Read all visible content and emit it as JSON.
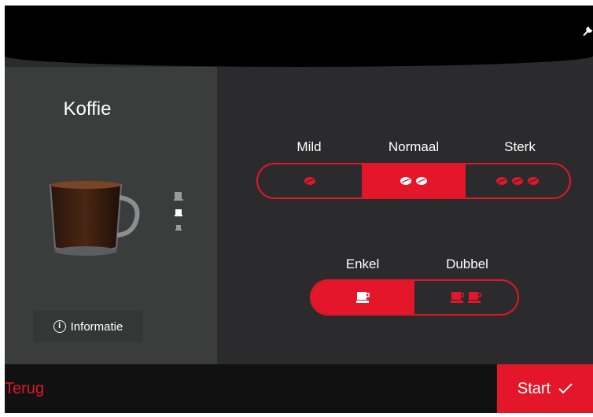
{
  "colors": {
    "accent": "#e3162a",
    "background": "#2b2b2d",
    "panel": "#3b3d3c"
  },
  "product": {
    "title": "Koffie",
    "info_label": "Informatie"
  },
  "strength": {
    "options": [
      {
        "label": "Mild",
        "beans": 1,
        "selected": false
      },
      {
        "label": "Normaal",
        "beans": 2,
        "selected": true
      },
      {
        "label": "Sterk",
        "beans": 3,
        "selected": false
      }
    ]
  },
  "quantity": {
    "options": [
      {
        "label": "Enkel",
        "cups": 1,
        "selected": true
      },
      {
        "label": "Dubbel",
        "cups": 2,
        "selected": false
      }
    ]
  },
  "footer": {
    "back_label": "Terug",
    "start_label": "Start"
  },
  "icons": {
    "settings": "wrench-icon",
    "info": "info-icon",
    "confirm": "check-icon"
  }
}
